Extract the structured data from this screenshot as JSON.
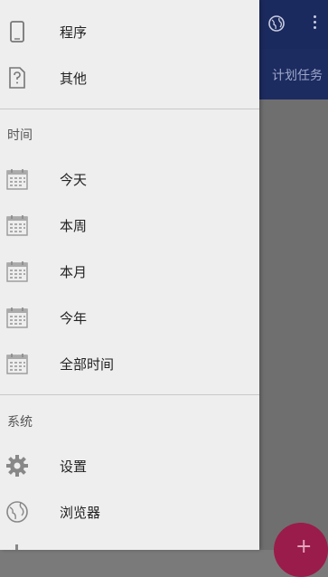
{
  "background": {
    "tab_label": "计划任务"
  },
  "drawer": {
    "top_items": [
      {
        "label": "程序",
        "icon": "phone-icon"
      },
      {
        "label": "其他",
        "icon": "unknown-file-icon"
      }
    ],
    "time_section": {
      "title": "时间",
      "items": [
        {
          "label": "今天",
          "icon": "calendar-icon"
        },
        {
          "label": "本周",
          "icon": "calendar-icon"
        },
        {
          "label": "本月",
          "icon": "calendar-icon"
        },
        {
          "label": "今年",
          "icon": "calendar-icon"
        },
        {
          "label": "全部时间",
          "icon": "calendar-icon"
        }
      ]
    },
    "system_section": {
      "title": "系统",
      "items": [
        {
          "label": "设置",
          "icon": "gear-icon"
        },
        {
          "label": "浏览器",
          "icon": "globe-icon"
        }
      ]
    }
  }
}
